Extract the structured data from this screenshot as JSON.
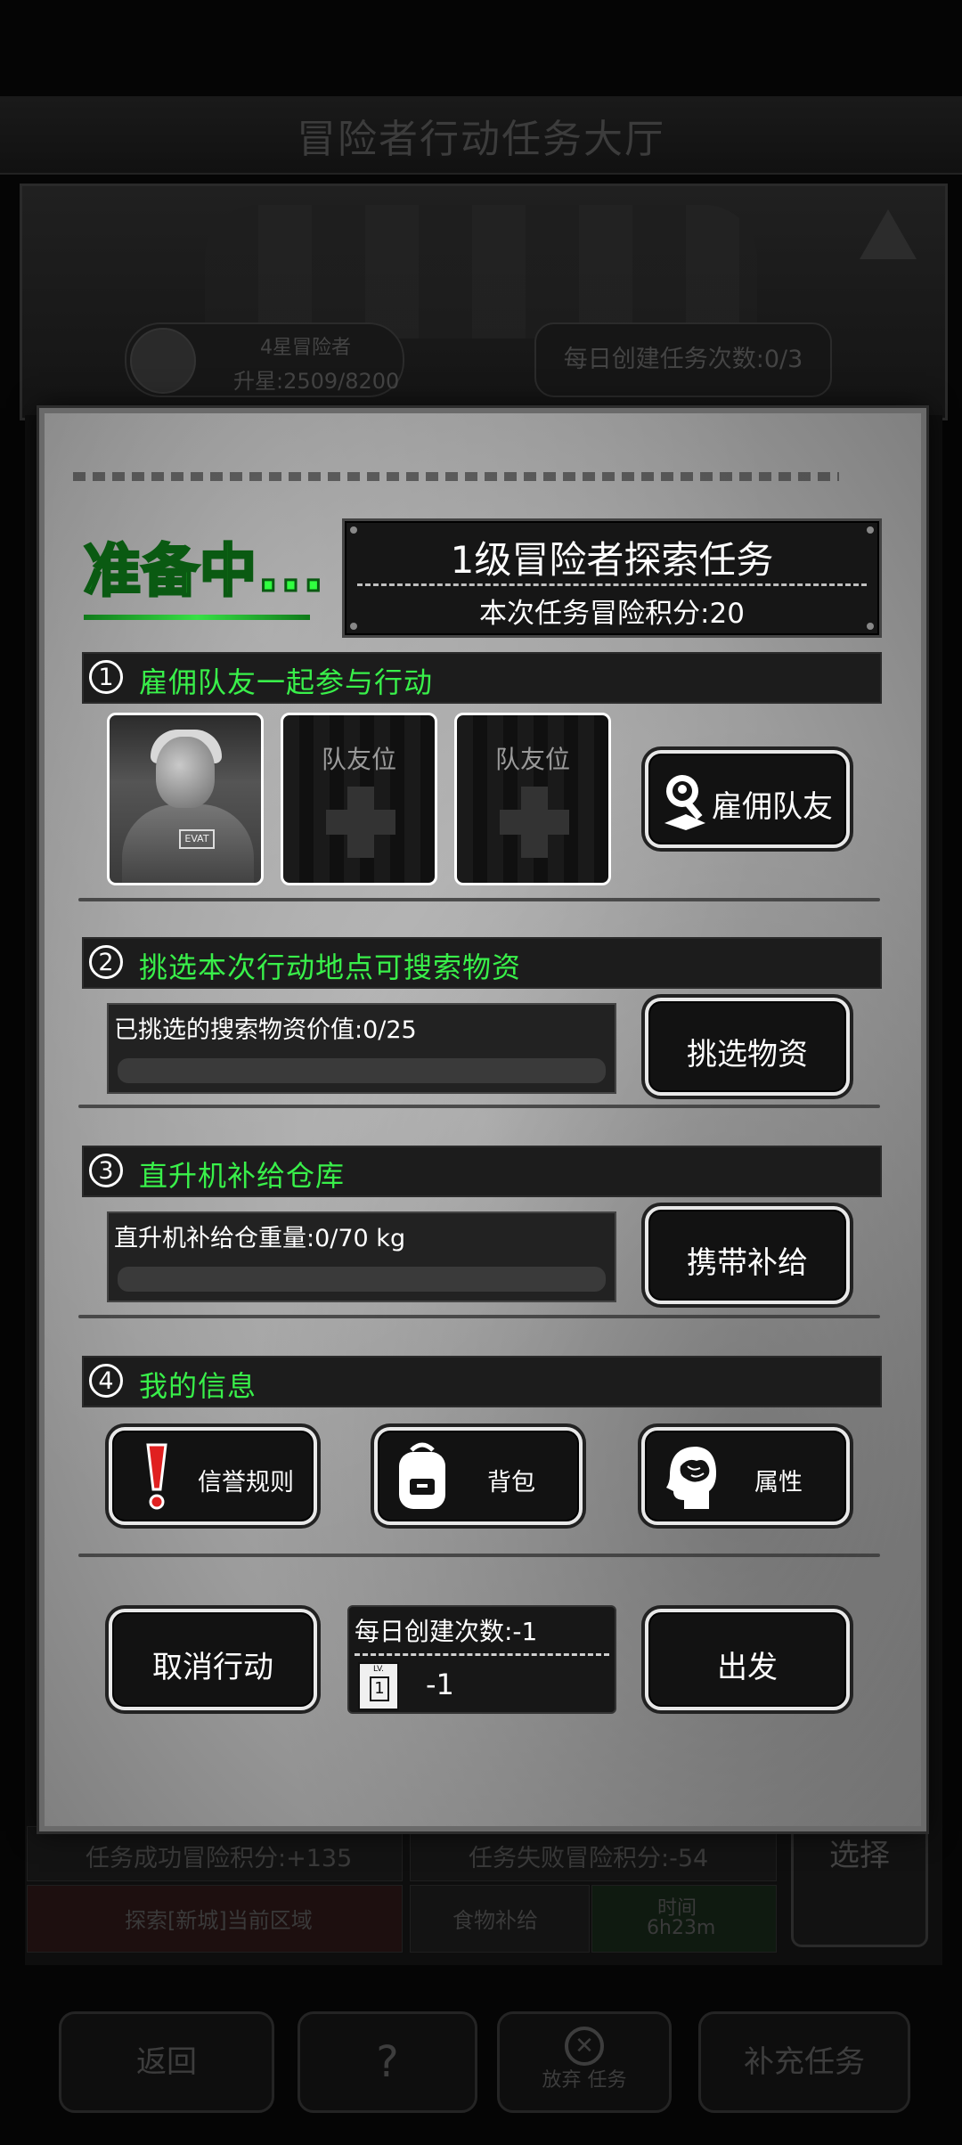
{
  "background": {
    "title": "冒险者行动任务大厅",
    "rank_title": "4星冒险者",
    "rank_progress": "升星:2509/8200",
    "daily_create": "每日创建任务次数:0/3",
    "rows": {
      "success_score": "任务成功冒险积分:+135",
      "fail_score": "任务失败冒险积分:-54",
      "explore": "探索[新城]当前区域",
      "food": "食物补给",
      "time_label": "时间",
      "time_value": "6h23m",
      "select": "选择"
    },
    "bottom_nav": {
      "back": "返回",
      "abandon": "放弃 任务",
      "refill": "补充任务"
    }
  },
  "modal": {
    "status": "准备中...",
    "task_title": "1级冒险者探索任务",
    "task_score": "本次任务冒险积分:20",
    "sections": [
      {
        "num": "1",
        "label": "雇佣队友一起参与行动"
      },
      {
        "num": "2",
        "label": "挑选本次行动地点可搜索物资"
      },
      {
        "num": "3",
        "label": "直升机补给仓库"
      },
      {
        "num": "4",
        "label": "我的信息"
      }
    ],
    "teammate_slot_label": "队友位",
    "hire_button": "雇佣队友",
    "supplies_value": "已挑选的搜索物资价值:0/25",
    "supplies_fraction": 0,
    "pick_supplies_button": "挑选物资",
    "heli_weight": "直升机补给仓重量:0/70 kg",
    "heli_fraction": 0,
    "carry_supplies_button": "携带补给",
    "credit_rules_button": "信誉规则",
    "backpack_button": "背包",
    "attributes_button": "属性",
    "cancel_button": "取消行动",
    "daily_count": "每日创建次数:-1",
    "lv_card_text": "LV.",
    "lv_card_num": "1",
    "daily_cost": "-1",
    "depart_button": "出发"
  },
  "colors": {
    "accent_green": "#39f04a",
    "status_green": "#30ff40"
  }
}
